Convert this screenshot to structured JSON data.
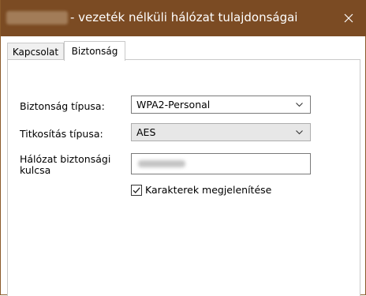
{
  "window": {
    "title": "- vezeték nélküli hálózat tulajdonságai",
    "accent_color": "#7b4b23",
    "close_icon": "close-icon"
  },
  "tabs": [
    {
      "label": "Kapcsolat",
      "selected": false
    },
    {
      "label": "Biztonság",
      "selected": true
    }
  ],
  "security": {
    "security_type_label": "Biztonság típusa:",
    "security_type_value": "WPA2-Personal",
    "encryption_type_label": "Titkosítás típusa:",
    "encryption_type_value": "AES",
    "network_key_label_line1": "Hálózat biztonsági",
    "network_key_label_line2": "kulcsa",
    "show_characters_label": "Karakterek megjelenítése",
    "show_characters_checked": true
  }
}
